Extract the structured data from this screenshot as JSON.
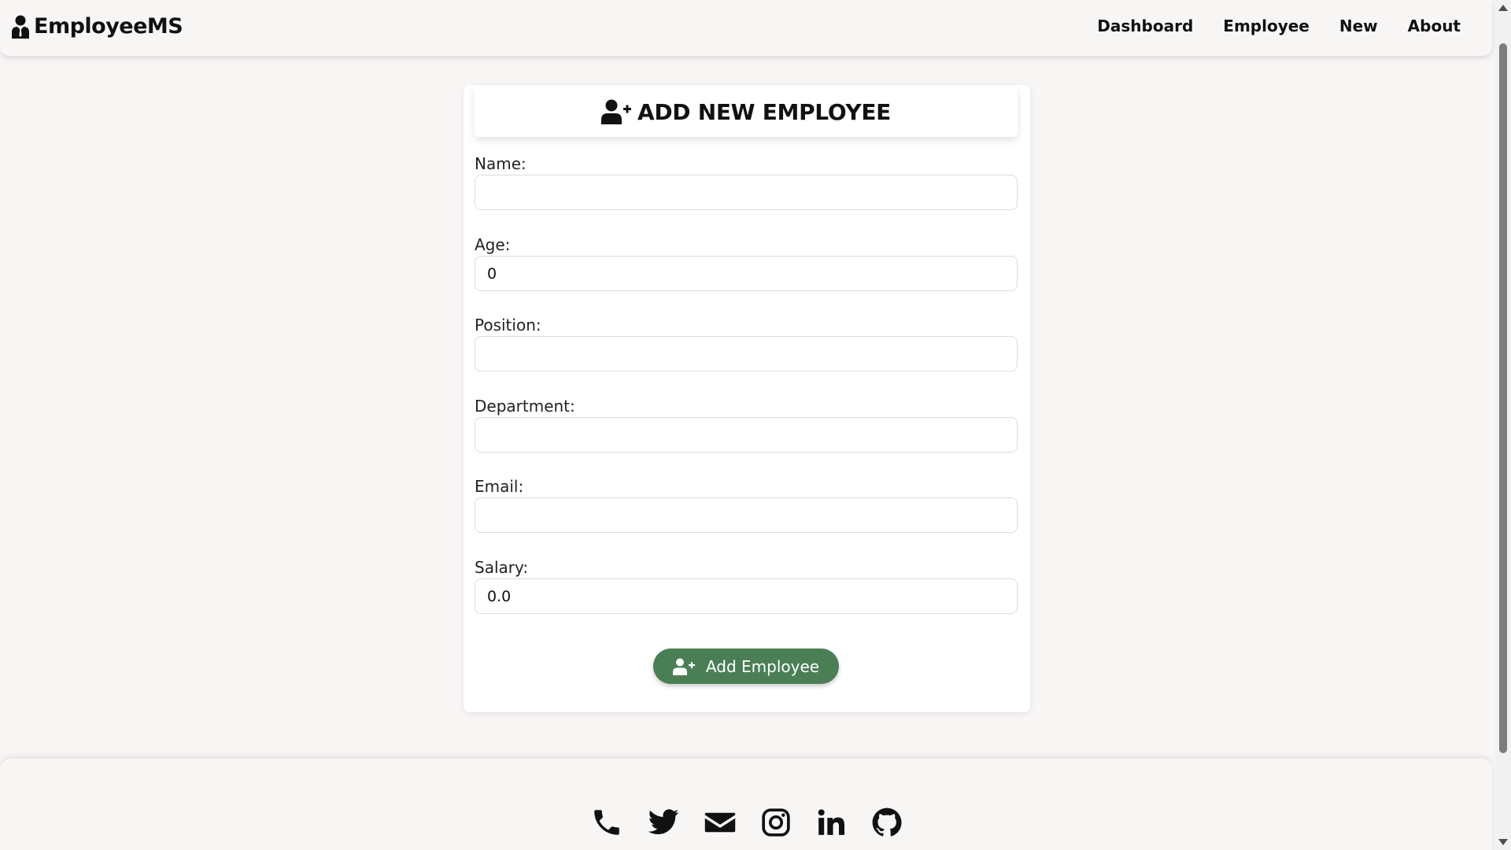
{
  "brand": {
    "name": "EmployeeMS",
    "icon": "user-tie-icon"
  },
  "nav": {
    "items": [
      {
        "label": "Dashboard"
      },
      {
        "label": "Employee"
      },
      {
        "label": "New"
      },
      {
        "label": "About"
      }
    ]
  },
  "form": {
    "title": "ADD NEW EMPLOYEE",
    "title_icon": "user-plus-icon",
    "fields": {
      "name": {
        "label": "Name:",
        "value": ""
      },
      "age": {
        "label": "Age:",
        "value": "0"
      },
      "position": {
        "label": "Position:",
        "value": ""
      },
      "department": {
        "label": "Department:",
        "value": ""
      },
      "email": {
        "label": "Email:",
        "value": ""
      },
      "salary": {
        "label": "Salary:",
        "value": "0.0"
      }
    },
    "submit_label": "Add Employee",
    "submit_color": "#4a7f56"
  },
  "footer": {
    "social_icons": [
      "phone-icon",
      "twitter-icon",
      "envelope-icon",
      "instagram-icon",
      "linkedin-icon",
      "github-icon"
    ]
  },
  "colors": {
    "background": "#f8f5f5",
    "card": "#ffffff",
    "accent": "#4a7f56"
  }
}
